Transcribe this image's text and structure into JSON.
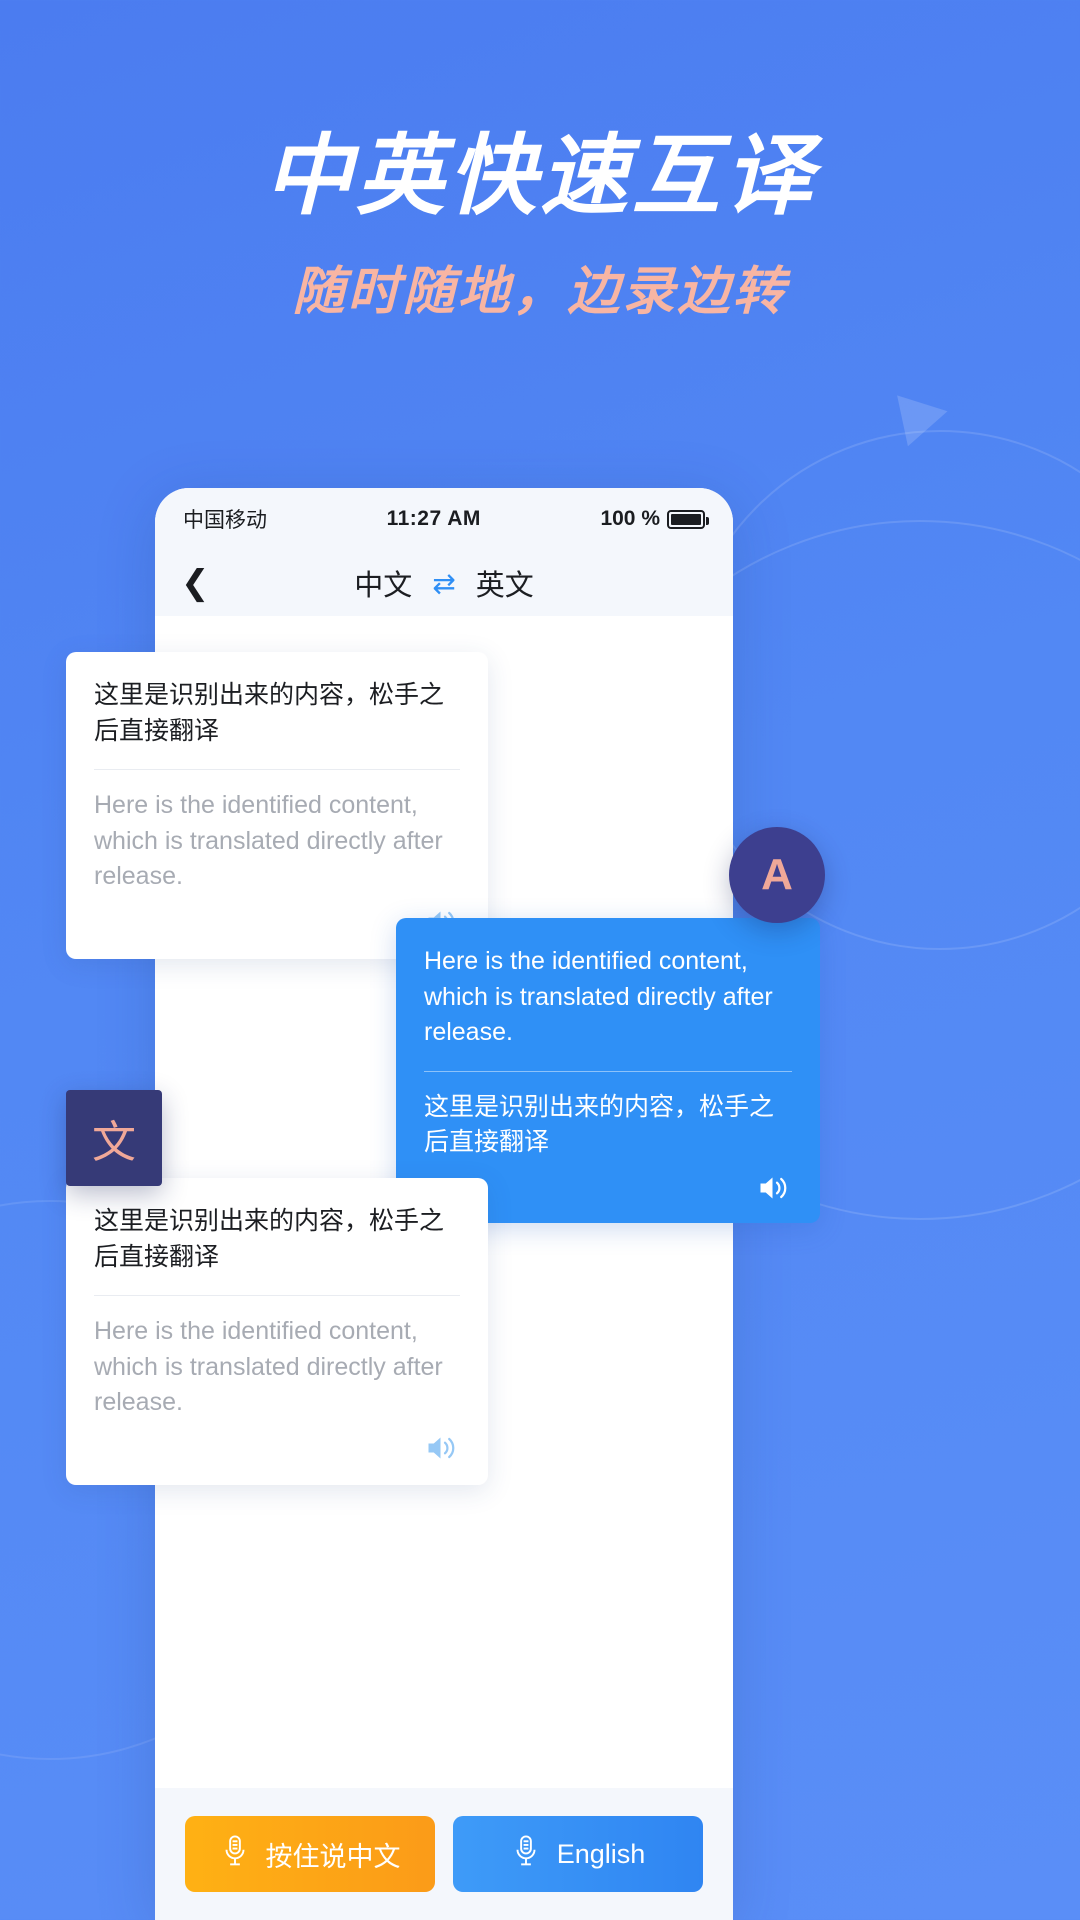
{
  "hero": {
    "title": "中英快速互译",
    "subtitle": "随时随地，边录边转",
    "title_color": "#ffffff",
    "subtitle_color": "#f8b5a3",
    "background_color": "#5288f4"
  },
  "phone": {
    "status_bar": {
      "carrier": "中国移动",
      "time": "11:27 AM",
      "battery_label": "100 %",
      "battery_icon": "battery-full-icon"
    },
    "nav_bar": {
      "back_icon": "chevron-left-icon",
      "source_language": "中文",
      "swap_icon": "swap-horizontal-icon",
      "target_language": "英文",
      "swap_color": "#2f8ff5"
    },
    "messages": [
      {
        "id": "message-1",
        "side": "left",
        "type": "card",
        "source_text": "这里是识别出来的内容，松手之后直接翻译",
        "translated_text": "Here is the identified content, which is translated directly after release.",
        "speaker_icon": "speaker-icon",
        "speaker_color": "#96c8f5"
      },
      {
        "id": "message-2",
        "side": "right",
        "type": "bubble",
        "source_text": "Here is the identified content, which is translated directly after release.",
        "translated_text": "这里是识别出来的内容，松手之后直接翻译",
        "speaker_icon": "speaker-icon",
        "speaker_color": "#ffffff",
        "bubble_color": "#2f90f6"
      },
      {
        "id": "message-3",
        "side": "left",
        "type": "card",
        "source_text": "这里是识别出来的内容，松手之后直接翻译",
        "translated_text": "Here is the identified content, which is translated directly after release.",
        "speaker_icon": "speaker-icon",
        "speaker_color": "#96c8f5"
      }
    ],
    "badges": {
      "avatar_letter": "A",
      "avatar_color": "#3d3f8f",
      "tile_letter": "文",
      "tile_color": "#363a77",
      "letter_color": "#f0a898"
    },
    "bottom_bar": {
      "buttons": [
        {
          "label": "按住说中文",
          "icon": "microphone-icon",
          "color": "#fb9b18"
        },
        {
          "label": "English",
          "icon": "microphone-icon",
          "color": "#2f85f2"
        }
      ]
    }
  }
}
